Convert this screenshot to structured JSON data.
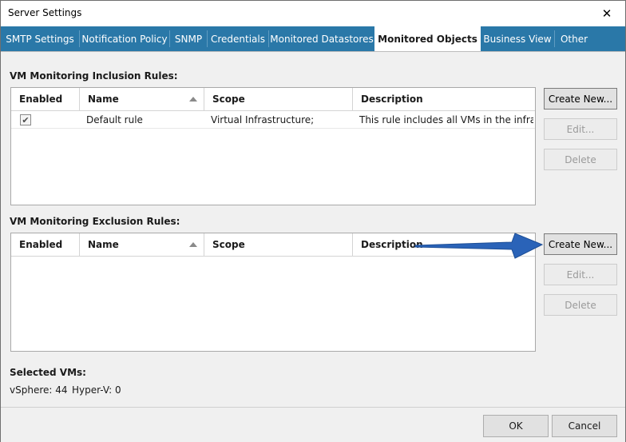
{
  "window": {
    "title": "Server Settings"
  },
  "tabs": [
    {
      "label": "SMTP Settings"
    },
    {
      "label": "Notification Policy"
    },
    {
      "label": "SNMP"
    },
    {
      "label": "Credentials"
    },
    {
      "label": "Monitored Datastores"
    },
    {
      "label": "Monitored Objects"
    },
    {
      "label": "Business View"
    },
    {
      "label": "Other"
    }
  ],
  "active_tab": "Monitored Objects",
  "inclusion": {
    "title": "VM Monitoring Inclusion Rules:",
    "columns": [
      "Enabled",
      "Name",
      "Scope",
      "Description"
    ],
    "rows": [
      {
        "enabled": true,
        "name": "Default rule",
        "scope": "Virtual Infrastructure;",
        "description": "This rule includes all VMs in the infras..."
      }
    ],
    "buttons": {
      "create": "Create New...",
      "edit": "Edit...",
      "delete": "Delete"
    }
  },
  "exclusion": {
    "title": "VM Monitoring Exclusion Rules:",
    "columns": [
      "Enabled",
      "Name",
      "Scope",
      "Description"
    ],
    "buttons": {
      "create": "Create New...",
      "edit": "Edit...",
      "delete": "Delete"
    }
  },
  "selected": {
    "title": "Selected VMs:",
    "vsphere": "vSphere: 44",
    "hyperv": "Hyper-V: 0"
  },
  "footer": {
    "ok": "OK",
    "cancel": "Cancel"
  },
  "colors": {
    "tab_bar": "#2a78a8",
    "annotation_arrow": "#2a63b8"
  },
  "icons": {
    "close": "close-icon",
    "sort": "sort-ascending-icon",
    "check": "checkmark-icon",
    "annotation": "callout-arrow-icon"
  }
}
